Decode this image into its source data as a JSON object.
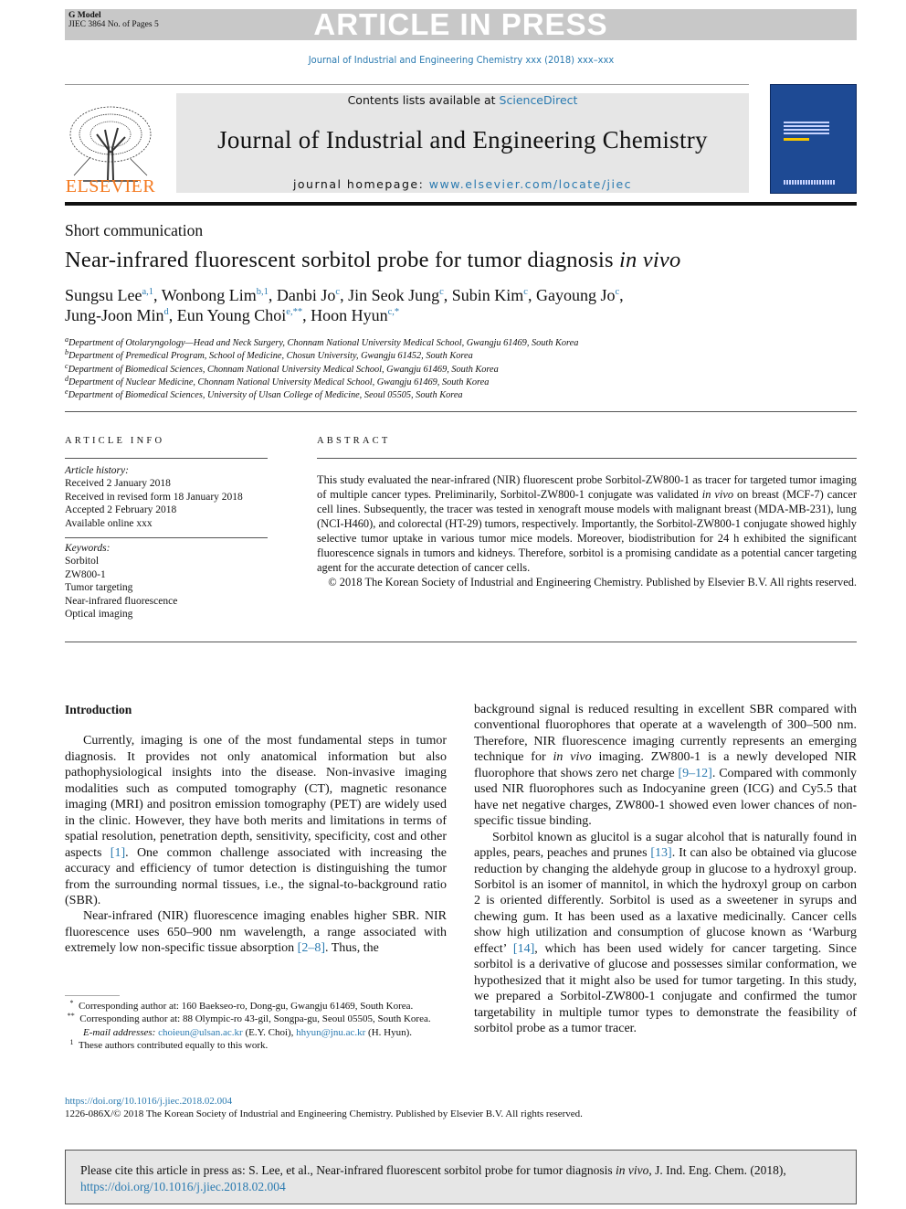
{
  "header": {
    "gmodel": "G Model",
    "jiec": "JIEC 3864 No. of Pages 5",
    "banner": "ARTICLE IN PRESS",
    "journal_ref": "Journal of Industrial and Engineering Chemistry xxx (2018) xxx–xxx"
  },
  "masthead": {
    "contents_prefix": "Contents lists available at ",
    "sciencedirect": "ScienceDirect",
    "journal_title": "Journal of Industrial and Engineering Chemistry",
    "homepage_prefix": "journal homepage: ",
    "homepage_url": "www.elsevier.com/locate/jiec",
    "publisher": "ELSEVIER"
  },
  "article": {
    "type": "Short communication",
    "title": "Near-infrared fluorescent sorbitol probe for tumor diagnosis ",
    "title_italic": "in vivo",
    "authors": [
      {
        "name": "Sungsu Lee",
        "sup": "a,1"
      },
      {
        "name": "Wonbong Lim",
        "sup": "b,1"
      },
      {
        "name": "Danbi Jo",
        "sup": "c"
      },
      {
        "name": "Jin Seok Jung",
        "sup": "c"
      },
      {
        "name": "Subin Kim",
        "sup": "c"
      },
      {
        "name": "Gayoung Jo",
        "sup": "c"
      },
      {
        "name": "Jung-Joon Min",
        "sup": "d"
      },
      {
        "name": "Eun Young Choi",
        "sup": "e,**"
      },
      {
        "name": "Hoon Hyun",
        "sup": "c,*"
      }
    ],
    "affiliations": [
      {
        "key": "a",
        "text": "Department of Otolaryngology—Head and Neck Surgery, Chonnam National University Medical School, Gwangju 61469, South Korea"
      },
      {
        "key": "b",
        "text": "Department of Premedical Program, School of Medicine, Chosun University, Gwangju 61452, South Korea"
      },
      {
        "key": "c",
        "text": "Department of Biomedical Sciences, Chonnam National University Medical School, Gwangju 61469, South Korea"
      },
      {
        "key": "d",
        "text": "Department of Nuclear Medicine, Chonnam National University Medical School, Gwangju 61469, South Korea"
      },
      {
        "key": "e",
        "text": "Department of Biomedical Sciences, University of Ulsan College of Medicine, Seoul 05505, South Korea"
      }
    ]
  },
  "info": {
    "heading": "ARTICLE INFO",
    "history_label": "Article history:",
    "history": [
      "Received 2 January 2018",
      "Received in revised form 18 January 2018",
      "Accepted 2 February 2018",
      "Available online xxx"
    ],
    "keywords_label": "Keywords:",
    "keywords": [
      "Sorbitol",
      "ZW800-1",
      "Tumor targeting",
      "Near-infrared fluorescence",
      "Optical imaging"
    ]
  },
  "abstract": {
    "heading": "ABSTRACT",
    "text": [
      {
        "t": "This study evaluated the near-infrared (NIR) fluorescent probe Sorbitol-ZW800-1 as tracer for targeted tumor imaging of multiple cancer types. Preliminarily, Sorbitol-ZW800-1 conjugate was validated "
      },
      {
        "t": "in vivo",
        "i": 1
      },
      {
        "t": " on breast (MCF-7) cancer cell lines. Subsequently, the tracer was tested in xenograft mouse models with malignant breast (MDA-MB-231), lung (NCI-H460), and colorectal (HT-29) tumors, respectively. Importantly, the Sorbitol-ZW800-1 conjugate showed highly selective tumor uptake in various tumor mice models. Moreover, biodistribution for 24 h exhibited the significant fluorescence signals in tumors and kidneys. Therefore, sorbitol is a promising candidate as a potential cancer targeting agent for the accurate detection of cancer cells."
      }
    ],
    "copyright": "© 2018 The Korean Society of Industrial and Engineering Chemistry. Published by Elsevier B.V. All rights reserved."
  },
  "body": {
    "intro_heading": "Introduction",
    "left_paragraphs": [
      [
        {
          "t": "Currently, imaging is one of the most fundamental steps in tumor diagnosis. It provides not only anatomical information but also pathophysiological insights into the disease. Non-invasive imaging modalities such as computed tomography (CT), magnetic resonance imaging (MRI) and positron emission tomography (PET) are widely used in the clinic. However, they have both merits and limitations in terms of spatial resolution, penetration depth, sensitivity, specificity, cost and other aspects "
        },
        {
          "t": "[1]",
          "l": 1
        },
        {
          "t": ". One common challenge associated with increasing the accuracy and efficiency of tumor detection is distinguishing the tumor from the surrounding normal tissues, i.e., the signal-to-background ratio (SBR)."
        }
      ],
      [
        {
          "t": "Near-infrared (NIR) fluorescence imaging enables higher SBR. NIR fluorescence uses 650–900 nm wavelength, a range associated with extremely low non-specific tissue absorption "
        },
        {
          "t": "[2–8]",
          "l": 1
        },
        {
          "t": ". Thus, the"
        }
      ]
    ],
    "right_paragraphs": [
      [
        {
          "t": "background signal is reduced resulting in excellent SBR compared with conventional fluorophores that operate at a wavelength of 300–500 nm. Therefore, NIR fluorescence imaging currently represents an emerging technique for "
        },
        {
          "t": "in vivo",
          "i": 1
        },
        {
          "t": " imaging. ZW800-1 is a newly developed NIR fluorophore that shows zero net charge "
        },
        {
          "t": "[9–12]",
          "l": 1
        },
        {
          "t": ". Compared with commonly used NIR fluorophores such as Indocyanine green (ICG) and Cy5.5 that have net negative charges, ZW800-1 showed even lower chances of non-specific tissue binding."
        }
      ],
      [
        {
          "t": "Sorbitol known as glucitol is a sugar alcohol that is naturally found in apples, pears, peaches and prunes "
        },
        {
          "t": "[13]",
          "l": 1
        },
        {
          "t": ". It can also be obtained via glucose reduction by changing the aldehyde group in glucose to a hydroxyl group. Sorbitol is an isomer of mannitol, in which the hydroxyl group on carbon 2 is oriented differently. Sorbitol is used as a sweetener in syrups and chewing gum. It has been used as a laxative medicinally. Cancer cells show high utilization and consumption of glucose known as ‘Warburg effect’ "
        },
        {
          "t": "[14]",
          "l": 1
        },
        {
          "t": ", which has been used widely for cancer targeting. Since sorbitol is a derivative of glucose and possesses similar conformation, we hypothesized that it might also be used for tumor targeting. In this study, we prepared a Sorbitol-ZW800-1 conjugate and confirmed the tumor targetability in multiple tumor types to demonstrate the feasibility of sorbitol probe as a tumor tracer."
        }
      ]
    ]
  },
  "footnotes": {
    "star1": "Corresponding author at: 160 Baekseo-ro, Dong-gu, Gwangju 61469, South Korea.",
    "star2": "Corresponding author at: 88 Olympic-ro 43-gil, Songpa-gu, Seoul 05505, South Korea.",
    "email_label": "E-mail addresses: ",
    "email1": "choieun@ulsan.ac.kr",
    "email1_who": " (E.Y. Choi), ",
    "email2": "hhyun@jnu.ac.kr",
    "email2_who": " (H. Hyun).",
    "one": "These authors contributed equally to this work.",
    "doi": "https://doi.org/10.1016/j.jiec.2018.02.004",
    "issn": "1226-086X/© 2018 The Korean Society of Industrial and Engineering Chemistry. Published by Elsevier B.V. All rights reserved."
  },
  "cite_box": {
    "prefix": "Please cite this article in press as: S. Lee, et al., Near-infrared fluorescent sorbitol probe for tumor diagnosis ",
    "italic": "in vivo",
    "suffix": ", J. Ind. Eng. Chem. (2018), ",
    "doi": "https://doi.org/10.1016/j.jiec.2018.02.004"
  },
  "colors": {
    "link": "#2a7ab0",
    "elsevier": "#f47a20",
    "banner_bg": "#c8c8c8",
    "cover": "#1e4a94"
  }
}
